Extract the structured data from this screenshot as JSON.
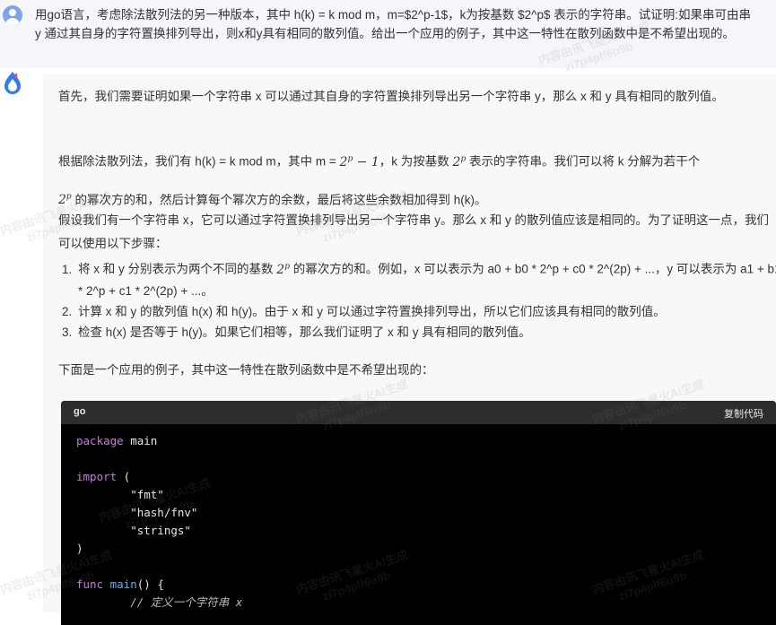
{
  "question": {
    "text": "用go语言，考虑除法散列法的另一种版本，其中 h(k) = k mod m，m=$2^p-1$，k为按基数 $2^p$ 表示的字符串。试证明:如果串可由串 y 通过其自身的字符置换排列导出，则x和y具有相同的散列值。给出一个应用的例子，其中这一特性在散列函数中是不希望出现的。"
  },
  "answer": {
    "p1": "首先，我们需要证明如果一个字符串 x 可以通过其自身的字符置换排列导出另一个字符串 y，那么 x 和 y 具有相同的散列值。",
    "p2_a": "根据除法散列法，我们有 h(k) = k mod m，其中 m = ",
    "p2_math1": "2",
    "p2_math1_sup": "p",
    "p2_math1_tail": " − 1",
    "p2_b": "，k 为按基数 ",
    "p2_math2": "2",
    "p2_math2_sup": "p",
    "p2_c": " 表示的字符串。我们可以将 k 分解为若干个",
    "p2_math3": "2",
    "p2_math3_sup": "p",
    "p2_d": " 的幂次方的和，然后计算每个幂次方的余数，最后将这些余数相加得到 h(k)。",
    "p3": "假设我们有一个字符串 x，它可以通过字符置换排列导出另一个字符串 y。那么 x 和 y 的散列值应该是相同的。为了证明这一点，我们可以使用以下步骤：",
    "step1_a": "将 x 和 y 分别表示为两个不同的基数 ",
    "step1_math": "2",
    "step1_math_sup": "p",
    "step1_b": " 的幂次方的和。例如，x 可以表示为 a0 + b0 * 2^p + c0 * 2^(2p) + ...，y 可以表示为 a1 + b1 * 2^p + c1 * 2^(2p) + ...。",
    "step2": "计算 x 和 y 的散列值 h(x) 和 h(y)。由于 x 和 y 可以通过字符置换排列导出，所以它们应该具有相同的散列值。",
    "step3": "检查 h(x) 是否等于 h(y)。如果它们相等，那么我们证明了 x 和 y 具有相同的散列值。",
    "p4": "下面是一个应用的例子，其中这一特性在散列函数中是不希望出现的："
  },
  "code": {
    "language": "go",
    "copy_label": "复制代码",
    "lines": {
      "l1_kw": "package",
      "l1_rest": " main",
      "l3_kw": "import",
      "l3_rest": " (",
      "l4": "        \"fmt\"",
      "l5": "        \"hash/fnv\"",
      "l6": "        \"strings\"",
      "l7": ")",
      "l9_kw": "func",
      "l9_fn": " main",
      "l9_rest": "() {",
      "l10": "        // 定义一个字符串 x"
    }
  },
  "watermark": {
    "line1": "内容由讯飞星火AI生成",
    "line2": "zi7p4plf6u9b"
  }
}
